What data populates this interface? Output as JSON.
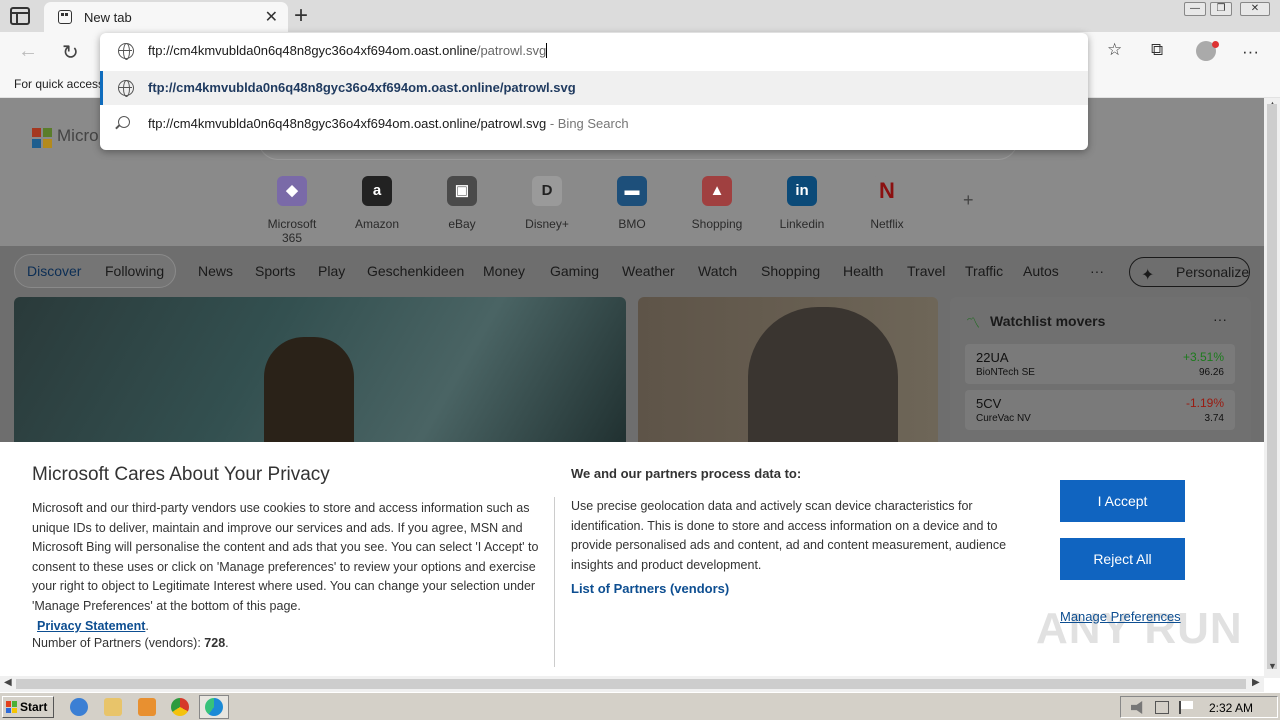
{
  "tab": {
    "title": "New tab",
    "close": "✕",
    "new_tab": "+"
  },
  "window_controls": {
    "minimize": "—",
    "maximize": "❐",
    "close": "✕"
  },
  "toolbar": {
    "back": "←",
    "refresh": "↻",
    "favorites": "☆",
    "collections": "⧉",
    "more": "···"
  },
  "favorites_bar": {
    "text": "For quick access"
  },
  "omnibox": {
    "typed_host": "ftp://cm4kmvublda0n6q48n8gyc36o4xf694om.oast.online",
    "typed_path": "/patrowl.svg",
    "suggestion_url": "ftp://cm4kmvublda0n6q48n8gyc36o4xf694om.oast.online/patrowl.svg",
    "suggestion_search": "ftp://cm4kmvublda0n6q48n8gyc36o4xf694om.oast.online/patrowl.svg",
    "suggestion_search_suffix": " - Bing Search"
  },
  "ntp": {
    "brand": "Micro",
    "quick_links": [
      {
        "label": "Microsoft 365",
        "glyph": "◆"
      },
      {
        "label": "Amazon",
        "glyph": "a"
      },
      {
        "label": "eBay",
        "glyph": "▣"
      },
      {
        "label": "Disney+",
        "glyph": "D"
      },
      {
        "label": "BMO",
        "glyph": "▬"
      },
      {
        "label": "Shopping",
        "glyph": "▲"
      },
      {
        "label": "Linkedin",
        "glyph": "in"
      },
      {
        "label": "Netflix",
        "glyph": "N"
      }
    ],
    "add_site": "+"
  },
  "feed": {
    "discover": "Discover",
    "following": "Following",
    "tabs": [
      "News",
      "Sports",
      "Play",
      "Geschenkideen",
      "Money",
      "Gaming",
      "Weather",
      "Watch",
      "Shopping",
      "Health",
      "Travel",
      "Traffic",
      "Autos",
      "···"
    ],
    "personalize": "Personalize"
  },
  "watchlist": {
    "title": "Watchlist movers",
    "menu": "···",
    "stocks": [
      {
        "symbol": "22UA",
        "name": "BioNTech SE",
        "change": "+3.51%",
        "price": "96.26",
        "positive": true
      },
      {
        "symbol": "5CV",
        "name": "CureVac NV",
        "change": "-1.19%",
        "price": "3.74",
        "positive": false
      }
    ]
  },
  "privacy": {
    "title": "Microsoft Cares About Your Privacy",
    "body": "Microsoft and our third-party vendors use cookies to store and access information such as unique IDs to deliver, maintain and improve our services and ads. If you agree, MSN and Microsoft Bing will personalise the content and ads that you see. You can select 'I Accept' to consent to these uses or click on 'Manage preferences' to review your options and exercise your right to object to Legitimate Interest where used.  You can change your selection under 'Manage Preferences' at the bottom of this page.",
    "privacy_link": "Privacy Statement",
    "privacy_link_suffix": ".",
    "partners_label": "Number of Partners (vendors): ",
    "partners_count": "728",
    "partners_suffix": ".",
    "right_title": "We and our partners process data to:",
    "right_body": "Use precise geolocation data and actively scan device characteristics for identification. This is done to store and access information on a device and to provide personalised ads and content, ad and content measurement, audience insights and product development.",
    "vendors_link": "List of Partners (vendors)",
    "accept": "I Accept",
    "reject": "Reject All",
    "manage": "Manage Preferences"
  },
  "watermark": "ANY RUN",
  "taskbar": {
    "start": "Start",
    "clock": "2:32 AM"
  },
  "colors": {
    "accent": "#1064c0",
    "positive": "#1d7a1d",
    "negative": "#c0261a"
  }
}
